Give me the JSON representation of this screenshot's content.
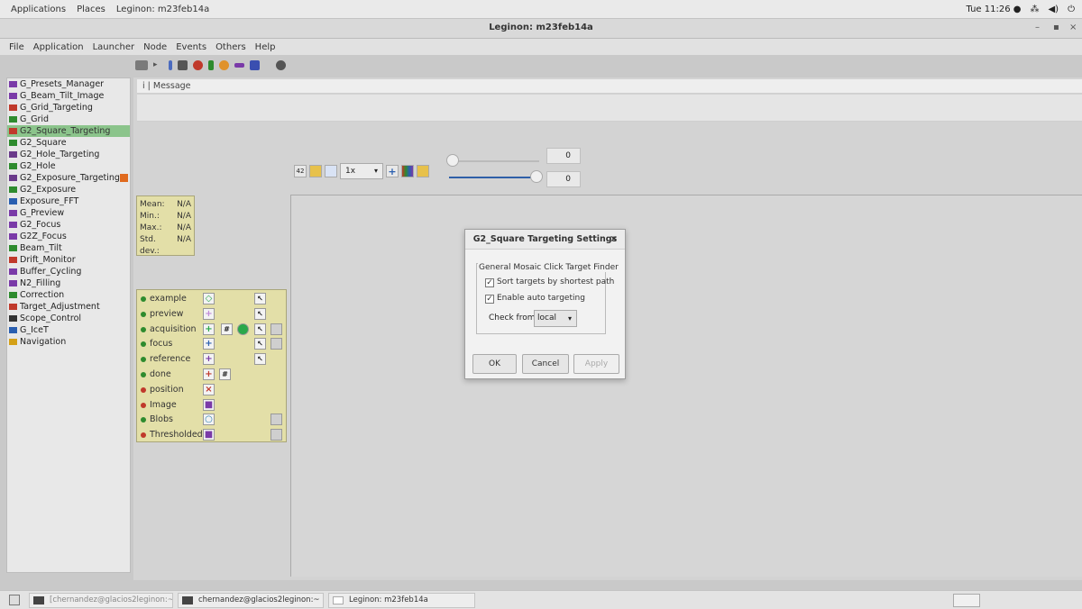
{
  "system_panel": {
    "applications": "Applications",
    "places": "Places",
    "window_name": "Leginon: m23feb14a",
    "clock": "Tue 11:26 ●"
  },
  "window": {
    "title": "Leginon: m23feb14a",
    "minimize": "–",
    "maximize": "▪",
    "close": "×"
  },
  "menu": [
    "File",
    "Application",
    "Launcher",
    "Node",
    "Events",
    "Others",
    "Help"
  ],
  "nodes": [
    {
      "label": "G_Presets_Manager",
      "color": "#7a3aa8"
    },
    {
      "label": "G_Beam_Tilt_Image",
      "color": "#7a3aa8"
    },
    {
      "label": "G_Grid_Targeting",
      "color": "#c0392b"
    },
    {
      "label": "G_Grid",
      "color": "#2e8b2e"
    },
    {
      "label": "G2_Square_Targeting",
      "color": "#c0392b"
    },
    {
      "label": "G2_Square",
      "color": "#2e8b2e"
    },
    {
      "label": "G2_Hole_Targeting",
      "color": "#6a3a8a"
    },
    {
      "label": "G2_Hole",
      "color": "#2e8b2e"
    },
    {
      "label": "G2_Exposure_Targeting",
      "color": "#6a3a8a"
    },
    {
      "label": "G2_Exposure",
      "color": "#2e8b2e"
    },
    {
      "label": "Exposure_FFT",
      "color": "#2a5fb0"
    },
    {
      "label": "G_Preview",
      "color": "#7a3aa8"
    },
    {
      "label": "G2_Focus",
      "color": "#7a3aa8"
    },
    {
      "label": "G2Z_Focus",
      "color": "#7a3aa8"
    },
    {
      "label": "Beam_Tilt",
      "color": "#2e8b2e"
    },
    {
      "label": "Drift_Monitor",
      "color": "#c0392b"
    },
    {
      "label": "Buffer_Cycling",
      "color": "#7a3aa8"
    },
    {
      "label": "N2_Filling",
      "color": "#7a3aa8"
    },
    {
      "label": "Correction",
      "color": "#2e8b2e"
    },
    {
      "label": "Target_Adjustment",
      "color": "#c0392b"
    },
    {
      "label": "Scope_Control",
      "color": "#333333"
    },
    {
      "label": "G_IceT",
      "color": "#2a5fb0"
    },
    {
      "label": "Navigation",
      "color": "#d4a017"
    }
  ],
  "selected_node_index": 4,
  "message_header": "i | Message",
  "image_tools": {
    "zoom": "1x",
    "range_min": "0",
    "range_max": "0"
  },
  "stats": [
    {
      "label": "Mean:",
      "value": "N/A"
    },
    {
      "label": "Min.:",
      "value": "N/A"
    },
    {
      "label": "Max.:",
      "value": "N/A"
    },
    {
      "label": "Std. dev.:",
      "value": "N/A"
    }
  ],
  "targets": [
    {
      "label": "example",
      "dot": "#2e8b2e",
      "symbol": "◇",
      "symbol_color": "#2aa84a"
    },
    {
      "label": "preview",
      "dot": "#2e8b2e",
      "symbol": "+",
      "symbol_color": "#c08ad8"
    },
    {
      "label": "acquisition",
      "dot": "#2e8b2e",
      "symbol": "+",
      "symbol_color": "#2aa84a"
    },
    {
      "label": "focus",
      "dot": "#2e8b2e",
      "symbol": "+",
      "symbol_color": "#2a5fb0"
    },
    {
      "label": "reference",
      "dot": "#2e8b2e",
      "symbol": "+",
      "symbol_color": "#7a3aa8"
    },
    {
      "label": "done",
      "dot": "#2e8b2e",
      "symbol": "+",
      "symbol_color": "#c0392b"
    },
    {
      "label": "position",
      "dot": "#c0392b",
      "symbol": "×",
      "symbol_color": "#c0392b"
    },
    {
      "label": "Image",
      "dot": "#c0392b",
      "symbol": "■",
      "symbol_color": "#7a3aa8"
    },
    {
      "label": "Blobs",
      "dot": "#2e8b2e",
      "symbol": "○",
      "symbol_color": "#2a7fb0"
    },
    {
      "label": "Thresholded",
      "dot": "#c0392b",
      "symbol": "■",
      "symbol_color": "#7a3aa8"
    }
  ],
  "dialog": {
    "title": "G2_Square Targeting Settings",
    "close": "×",
    "group_label": "General Mosaic Click Target Finder",
    "sort_label": "Sort targets by shortest path",
    "sort_checked": true,
    "auto_label": "Enable auto targeting",
    "auto_checked": true,
    "check_from_label": "Check from",
    "check_from_value": "local",
    "ok": "OK",
    "cancel": "Cancel",
    "apply": "Apply"
  },
  "taskbar": {
    "task1": "[chernandez@glacios2leginon:~]",
    "task2": "chernandez@glacios2leginon:~",
    "task3": "Leginon: m23feb14a"
  }
}
